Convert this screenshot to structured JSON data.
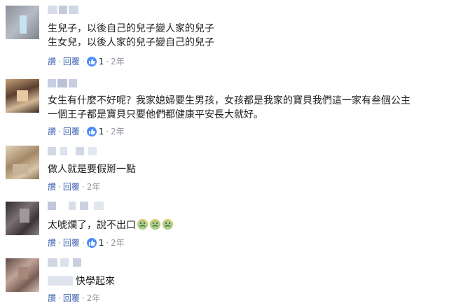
{
  "comments": [
    {
      "lines": [
        "生兒子，以後自己的兒子變人家的兒子",
        "生女兒，以後人家的兒子變自己的兒子"
      ],
      "actions": {
        "like": "讚",
        "reply": "回覆",
        "like_count": "1",
        "time": "2年"
      }
    },
    {
      "lines": [
        "女生有什麼不好呢？我家媳婦要生男孩，女孩都是我家的寶貝我們這一家有叁個公主",
        "一個王子都是寶貝只要他們都健康平安長大就好。"
      ],
      "actions": {
        "like": "讚",
        "reply": "回覆",
        "like_count": "1",
        "time": "2年"
      }
    },
    {
      "lines": [
        "做人就是要假掰一點"
      ],
      "actions": {
        "like": "讚",
        "reply": "回覆",
        "time": "2年"
      }
    },
    {
      "lines": [
        "太唬爛了，說不出口"
      ],
      "emoji": [
        "nauseated-face",
        "nauseated-face",
        "nauseated-face"
      ],
      "actions": {
        "like": "讚",
        "reply": "回覆",
        "like_count": "1",
        "time": "2年"
      }
    },
    {
      "lines": [
        "快學起來"
      ],
      "actions": {
        "like": "讚",
        "reply": "回覆",
        "time": "2年"
      }
    }
  ],
  "colors": {
    "link": "#4267b2",
    "meta": "#90949c",
    "like_badge": "#4a8cf7"
  }
}
